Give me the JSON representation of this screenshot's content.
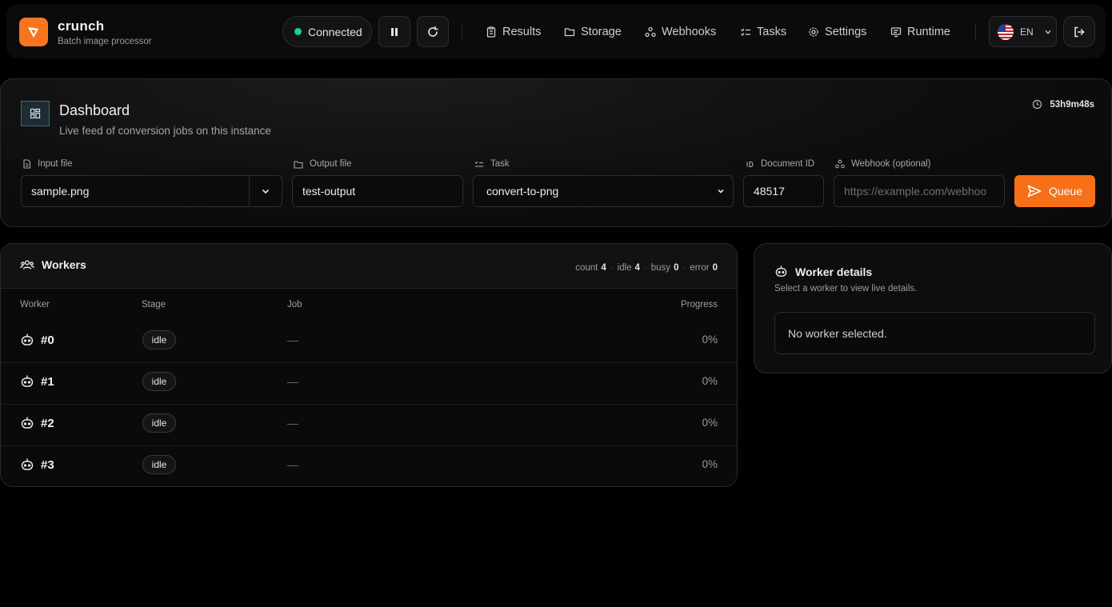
{
  "brand": {
    "name": "crunch",
    "subtitle": "Batch image processor"
  },
  "connection": {
    "status": "Connected",
    "color": "#1fcf8f"
  },
  "nav": [
    {
      "label": "Results",
      "icon": "clipboard-icon"
    },
    {
      "label": "Storage",
      "icon": "folder-icon"
    },
    {
      "label": "Webhooks",
      "icon": "webhook-icon"
    },
    {
      "label": "Tasks",
      "icon": "tasks-icon"
    },
    {
      "label": "Settings",
      "icon": "gear-icon"
    },
    {
      "label": "Runtime",
      "icon": "monitor-icon"
    }
  ],
  "language": {
    "code": "EN",
    "flag": "us-flag-icon"
  },
  "dashboard": {
    "title": "Dashboard",
    "subtitle": "Live feed of conversion jobs on this instance",
    "uptime": "53h9m48s"
  },
  "form": {
    "input_file": {
      "label": "Input file",
      "value": "sample.png"
    },
    "output_file": {
      "label": "Output file",
      "value": "test-output"
    },
    "task": {
      "label": "Task",
      "value": "convert-to-png"
    },
    "document_id": {
      "label": "Document ID",
      "value": "48517"
    },
    "webhook": {
      "label": "Webhook (optional)",
      "placeholder": "https://example.com/webhoo"
    },
    "queue_label": "Queue"
  },
  "workers": {
    "title": "Workers",
    "stats": {
      "count_label": "count",
      "count": "4",
      "idle_label": "idle",
      "idle": "4",
      "busy_label": "busy",
      "busy": "0",
      "error_label": "error",
      "error": "0"
    },
    "columns": {
      "worker": "Worker",
      "stage": "Stage",
      "job": "Job",
      "progress": "Progress"
    },
    "rows": [
      {
        "id": "#0",
        "stage": "idle",
        "job": "—",
        "progress": "0%"
      },
      {
        "id": "#1",
        "stage": "idle",
        "job": "—",
        "progress": "0%"
      },
      {
        "id": "#2",
        "stage": "idle",
        "job": "—",
        "progress": "0%"
      },
      {
        "id": "#3",
        "stage": "idle",
        "job": "—",
        "progress": "0%"
      }
    ]
  },
  "details": {
    "title": "Worker details",
    "subtitle": "Select a worker to view live details.",
    "empty": "No worker selected."
  },
  "colors": {
    "accent": "#f7761d",
    "queue_button": "#f77017",
    "background": "#000000"
  }
}
